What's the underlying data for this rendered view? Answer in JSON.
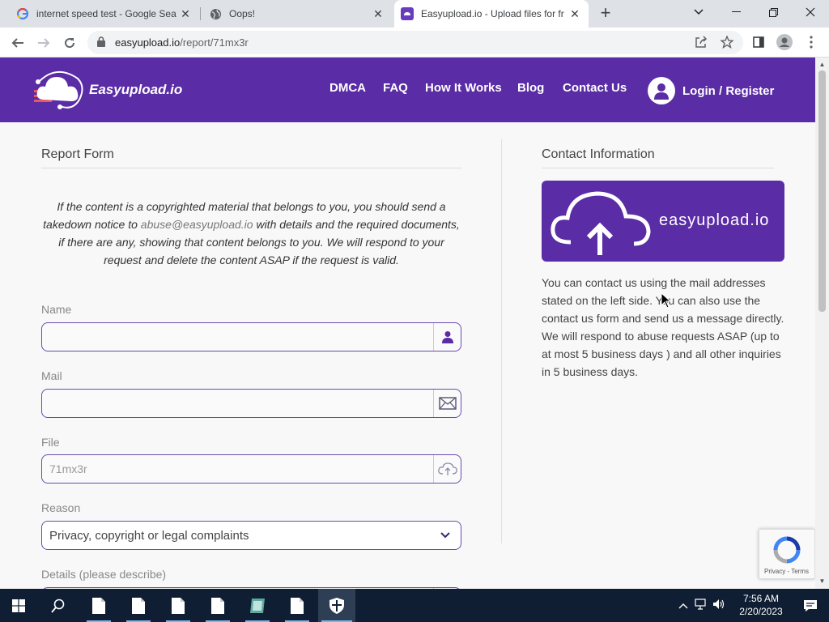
{
  "browser": {
    "tabs": [
      {
        "title": "internet speed test - Google Sea",
        "favicon": "google-g-icon"
      },
      {
        "title": "Oops!",
        "favicon": "globe-icon"
      },
      {
        "title": "Easyupload.io - Upload files for fr",
        "favicon": "easyupload-icon"
      }
    ],
    "url_host": "easyupload.io",
    "url_path": "/report/71mx3r"
  },
  "site": {
    "brand": "Easyupload.io",
    "nav": [
      "DMCA",
      "FAQ",
      "How It Works",
      "Blog",
      "Contact Us"
    ],
    "login": "Login / Register",
    "accent": "#5a2ca5"
  },
  "report": {
    "title": "Report Form",
    "notice_part1": "If the content is a copyrighted material that belongs to you, you should send a takedown notice to",
    "notice_email": "abuse@easyupload.io",
    "notice_part2": "with details and the required documents, if there are any, showing that content belongs to you. We will respond to your request and delete the content ASAP if the request is valid.",
    "name_label": "Name",
    "name_value": "",
    "mail_label": "Mail",
    "mail_value": "",
    "file_label": "File",
    "file_value": "71mx3r",
    "reason_label": "Reason",
    "reason_value": "Privacy, copyright or legal complaints",
    "details_label": "Details (please describe)"
  },
  "contact": {
    "title": "Contact Information",
    "card_word": "easyupload.io",
    "text": "You can contact us using the mail addresses stated on the left side. You can also use the contact us form and send us a message directly. We will respond to abuse requests ASAP (up to at most 5 business days ) and all other inquiries in 5 business days."
  },
  "recaptcha": {
    "links": "Privacy - Terms"
  },
  "taskbar": {
    "time": "7:56 AM",
    "date": "2/20/2023"
  }
}
